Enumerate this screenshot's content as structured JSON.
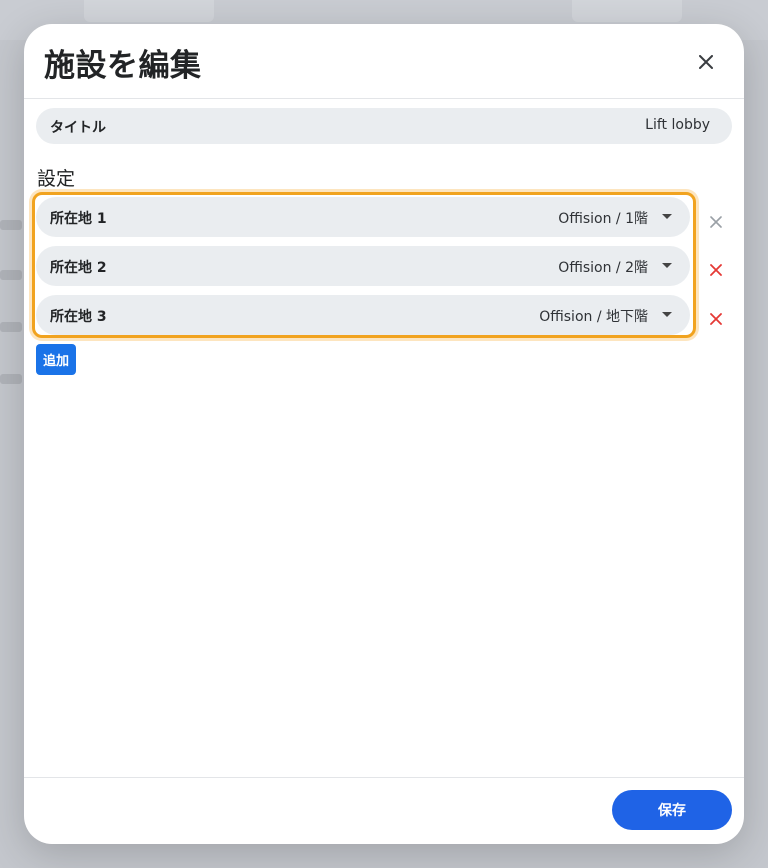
{
  "dialog": {
    "title": "施設を編集",
    "close_icon": "close-icon"
  },
  "title_field": {
    "label": "タイトル",
    "value": "Lift lobby"
  },
  "settings": {
    "section_title": "設定",
    "locations": [
      {
        "label": "所在地 1",
        "value": "Offision / 1階",
        "remove_enabled": false
      },
      {
        "label": "所在地 2",
        "value": "Offision / 2階",
        "remove_enabled": true
      },
      {
        "label": "所在地 3",
        "value": "Offision / 地下階",
        "remove_enabled": true
      }
    ],
    "add_label": "追加"
  },
  "footer": {
    "save_label": "保存"
  },
  "colors": {
    "primary": "#1f63e6",
    "highlight_border": "#f1a31f",
    "remove_active": "#e53935",
    "remove_disabled": "#9aa0a6"
  }
}
